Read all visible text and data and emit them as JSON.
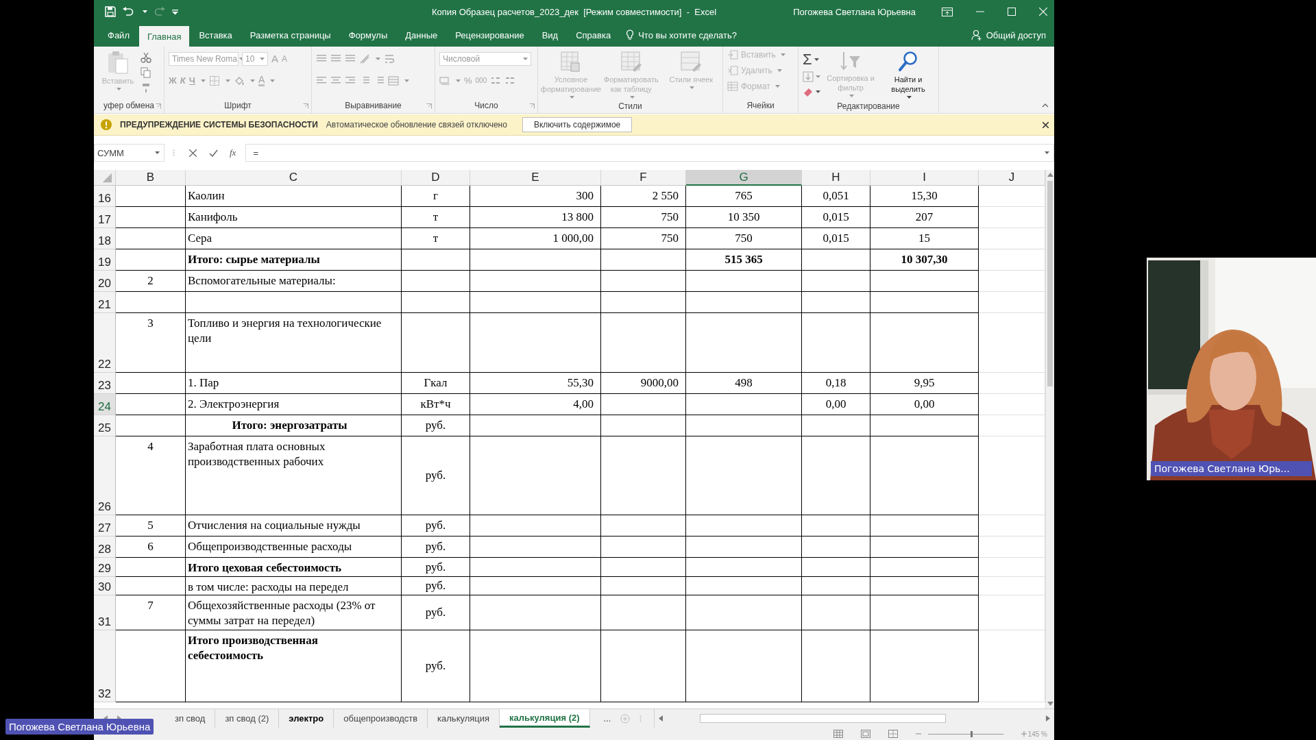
{
  "window": {
    "title": "Копия Образец расчетов_2023_дек  [Режим совместимости]  -  Excel",
    "user": "Погожева Светлана Юрьевна"
  },
  "menu_tabs": [
    {
      "label": "Файл",
      "selected": false
    },
    {
      "label": "Главная",
      "selected": true
    },
    {
      "label": "Вставка",
      "selected": false
    },
    {
      "label": "Разметка страницы",
      "selected": false
    },
    {
      "label": "Формулы",
      "selected": false
    },
    {
      "label": "Данные",
      "selected": false
    },
    {
      "label": "Рецензирование",
      "selected": false
    },
    {
      "label": "Вид",
      "selected": false
    },
    {
      "label": "Справка",
      "selected": false
    }
  ],
  "tell_me": "Что вы хотите сделать?",
  "share": "Общий доступ",
  "ribbon": {
    "clipboard": {
      "label": "уфер обмена",
      "paste": {
        "label": "Вставить",
        "disabled": true
      }
    },
    "font": {
      "label": "Шрифт",
      "font_name": "Times New Roma",
      "font_size": "10",
      "size_buttons": [
        "A",
        "A"
      ],
      "style_buttons": [
        "Ж",
        "К",
        "Ч"
      ],
      "color_button": "A"
    },
    "alignment": {
      "label": "Выравнивание"
    },
    "number": {
      "label": "Число",
      "format": "Числовой",
      "buttons": [
        "%",
        "000"
      ]
    },
    "styles": {
      "label": "Стили",
      "buttons": [
        {
          "label": "Условное форматирование",
          "disabled": true
        },
        {
          "label": "Форматировать как таблицу",
          "disabled": true
        },
        {
          "label": "Стили ячеек",
          "disabled": true
        }
      ]
    },
    "cells": {
      "label": "Ячейки",
      "buttons": [
        {
          "label": "Вставить",
          "disabled": true
        },
        {
          "label": "Удалить",
          "disabled": true
        },
        {
          "label": "Формат",
          "disabled": true
        }
      ]
    },
    "editing": {
      "label": "Редактирование",
      "autosum": "Σ",
      "buttons": [
        {
          "label": "Сортировка и фильтр",
          "disabled": true
        },
        {
          "label": "Найти и выделить",
          "disabled": false
        }
      ]
    }
  },
  "security_bar": {
    "title": "ПРЕДУПРЕЖДЕНИЕ СИСТЕМЫ БЕЗОПАСНОСТИ",
    "message": "Автоматическое обновление связей отключено",
    "button": "Включить содержимое"
  },
  "formula_bar": {
    "name_box": "СУММ",
    "function_button": "fx",
    "formula": "="
  },
  "sheet": {
    "columns": [
      {
        "label": "B",
        "selected": false
      },
      {
        "label": "C",
        "selected": false
      },
      {
        "label": "D",
        "selected": false
      },
      {
        "label": "E",
        "selected": false
      },
      {
        "label": "F",
        "selected": false
      },
      {
        "label": "G",
        "selected": true
      },
      {
        "label": "H",
        "selected": false
      },
      {
        "label": "I",
        "selected": false
      },
      {
        "label": "J",
        "selected": false
      }
    ],
    "rows": [
      {
        "number": "16",
        "selected": false,
        "kind": "item",
        "cells": [
          "",
          "Каолин",
          "г",
          "300",
          "2 550",
          "765",
          "0,051",
          "15,30",
          ""
        ]
      },
      {
        "number": "17",
        "selected": false,
        "kind": "item",
        "cells": [
          "",
          "Канифоль",
          "т",
          "13 800",
          "750",
          "10 350",
          "0,015",
          "207",
          ""
        ]
      },
      {
        "number": "18",
        "selected": false,
        "kind": "item",
        "cells": [
          "",
          "Сера",
          "т",
          "1 000,00",
          "750",
          "750",
          "0,015",
          "15",
          ""
        ]
      },
      {
        "number": "19",
        "selected": false,
        "kind": "total",
        "cells": [
          "",
          "Итого: сырье материалы",
          "",
          "",
          "",
          "515 365",
          "",
          "10 307,30",
          ""
        ]
      },
      {
        "number": "20",
        "selected": false,
        "kind": "item",
        "cells": [
          "2",
          "Вспомогательные материалы:",
          "",
          "",
          "",
          "",
          "",
          "",
          ""
        ]
      },
      {
        "number": "21",
        "selected": false,
        "kind": "item",
        "cells": [
          "",
          "",
          "",
          "",
          "",
          "",
          "",
          "",
          ""
        ]
      },
      {
        "number": "22",
        "selected": false,
        "kind": "item",
        "cells": [
          "3",
          "Топливо и энергия  на технологические цели",
          "",
          "",
          "",
          "",
          "",
          "",
          ""
        ]
      },
      {
        "number": "23",
        "selected": false,
        "kind": "item",
        "cells": [
          "",
          "1. Пар",
          "Гкал",
          "55,30",
          "9000,00",
          "498",
          "0,18",
          "9,95",
          ""
        ]
      },
      {
        "number": "24",
        "selected": true,
        "kind": "item",
        "cells": [
          "",
          "2. Электроэнергия",
          "кВт*ч",
          "4,00",
          "",
          "",
          "0,00",
          "0,00",
          ""
        ]
      },
      {
        "number": "25",
        "selected": false,
        "kind": "total-centered",
        "cells": [
          "",
          "Итого: энергозатраты",
          "руб.",
          "",
          "",
          "",
          "",
          "",
          ""
        ]
      },
      {
        "number": "26",
        "selected": false,
        "kind": "item",
        "cells": [
          "4",
          "Заработная плата основных производственных рабочих",
          "руб.",
          "",
          "",
          "",
          "",
          "",
          ""
        ]
      },
      {
        "number": "27",
        "selected": false,
        "kind": "item",
        "cells": [
          "5",
          "Отчисления на социальные нужды",
          "руб.",
          "",
          "",
          "",
          "",
          "",
          ""
        ]
      },
      {
        "number": "28",
        "selected": false,
        "kind": "item",
        "cells": [
          "6",
          "Общепроизводственные расходы",
          "руб.",
          "",
          "",
          "",
          "",
          "",
          ""
        ]
      },
      {
        "number": "29",
        "selected": false,
        "kind": "total",
        "cells": [
          "",
          "Итого цеховая себестоимость",
          "руб.",
          "",
          "",
          "",
          "",
          "",
          ""
        ]
      },
      {
        "number": "30",
        "selected": false,
        "kind": "item",
        "cells": [
          "",
          "в том числе: расходы на передел",
          "руб.",
          "",
          "",
          "",
          "",
          "",
          ""
        ]
      },
      {
        "number": "31",
        "selected": false,
        "kind": "item",
        "cells": [
          "7",
          "Общехозяйственные расходы (23% от суммы затрат на передел)",
          "руб.",
          "",
          "",
          "",
          "",
          "",
          ""
        ]
      },
      {
        "number": "32",
        "selected": false,
        "kind": "total",
        "cells": [
          "",
          "Итого производственная себестоимость",
          "руб.",
          "",
          "",
          "",
          "",
          "",
          ""
        ]
      }
    ]
  },
  "sheet_tabs": [
    {
      "label": "зп свод",
      "selected": false,
      "bold": false
    },
    {
      "label": "зп свод (2)",
      "selected": false,
      "bold": false
    },
    {
      "label": "электро",
      "selected": false,
      "bold": true
    },
    {
      "label": "общепроизводств",
      "selected": false,
      "bold": false
    },
    {
      "label": "калькуляция",
      "selected": false,
      "bold": false
    },
    {
      "label": "калькуляция (2)",
      "selected": true,
      "bold": false
    }
  ],
  "more_tabs": "...",
  "status_bar": {
    "zoom": "145 %"
  },
  "video": {
    "kind": "picture",
    "name": "Погожева Светлана Юрь..."
  },
  "presenter_label": "Погожева Светлана Юрьевна"
}
